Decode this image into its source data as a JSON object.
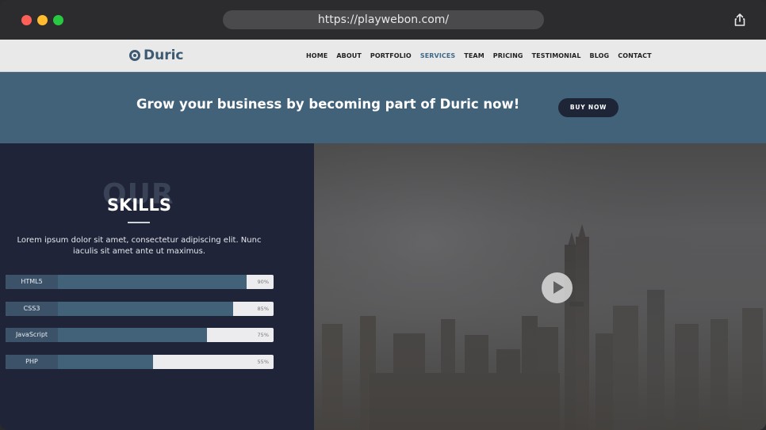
{
  "browser": {
    "url": "https://playwebon.com/"
  },
  "brand": {
    "name": "Duric",
    "accent": "#3e5a73"
  },
  "nav": {
    "items": [
      {
        "label": "HOME"
      },
      {
        "label": "ABOUT"
      },
      {
        "label": "PORTFOLIO"
      },
      {
        "label": "SERVICES",
        "active": true
      },
      {
        "label": "TEAM"
      },
      {
        "label": "PRICING"
      },
      {
        "label": "TESTIMONIAL"
      },
      {
        "label": "BLOG"
      },
      {
        "label": "CONTACT"
      }
    ]
  },
  "banner": {
    "headline": "Grow your business by becoming part of Duric now!",
    "button_label": "BUY NOW"
  },
  "skills": {
    "ghost_title": "OUR",
    "title": "SKILLS",
    "description": "Lorem ipsum dolor sit amet, consectetur adipiscing elit. Nunc iaculis sit amet ante ut maximus.",
    "items": [
      {
        "label": "HTML5",
        "percent": 90,
        "percent_label": "90%"
      },
      {
        "label": "CSS3",
        "percent": 85,
        "percent_label": "85%"
      },
      {
        "label": "JavaScript",
        "percent": 75,
        "percent_label": "75%"
      },
      {
        "label": "PHP",
        "percent": 55,
        "percent_label": "55%"
      }
    ]
  },
  "video": {
    "play_icon": "play-icon"
  }
}
